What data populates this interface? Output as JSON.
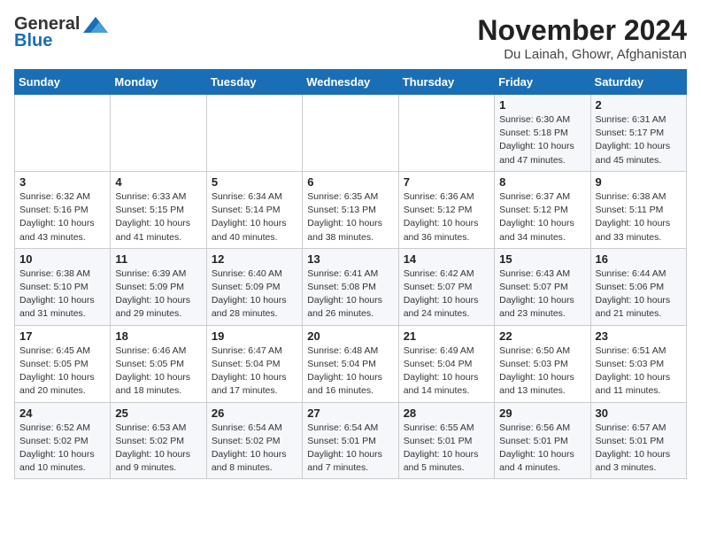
{
  "logo": {
    "line1": "General",
    "line2": "Blue"
  },
  "title": "November 2024",
  "subtitle": "Du Lainah, Ghowr, Afghanistan",
  "header_color": "#1a6eb5",
  "days_of_week": [
    "Sunday",
    "Monday",
    "Tuesday",
    "Wednesday",
    "Thursday",
    "Friday",
    "Saturday"
  ],
  "weeks": [
    [
      {
        "day": "",
        "info": ""
      },
      {
        "day": "",
        "info": ""
      },
      {
        "day": "",
        "info": ""
      },
      {
        "day": "",
        "info": ""
      },
      {
        "day": "",
        "info": ""
      },
      {
        "day": "1",
        "info": "Sunrise: 6:30 AM\nSunset: 5:18 PM\nDaylight: 10 hours and 47 minutes."
      },
      {
        "day": "2",
        "info": "Sunrise: 6:31 AM\nSunset: 5:17 PM\nDaylight: 10 hours and 45 minutes."
      }
    ],
    [
      {
        "day": "3",
        "info": "Sunrise: 6:32 AM\nSunset: 5:16 PM\nDaylight: 10 hours and 43 minutes."
      },
      {
        "day": "4",
        "info": "Sunrise: 6:33 AM\nSunset: 5:15 PM\nDaylight: 10 hours and 41 minutes."
      },
      {
        "day": "5",
        "info": "Sunrise: 6:34 AM\nSunset: 5:14 PM\nDaylight: 10 hours and 40 minutes."
      },
      {
        "day": "6",
        "info": "Sunrise: 6:35 AM\nSunset: 5:13 PM\nDaylight: 10 hours and 38 minutes."
      },
      {
        "day": "7",
        "info": "Sunrise: 6:36 AM\nSunset: 5:12 PM\nDaylight: 10 hours and 36 minutes."
      },
      {
        "day": "8",
        "info": "Sunrise: 6:37 AM\nSunset: 5:12 PM\nDaylight: 10 hours and 34 minutes."
      },
      {
        "day": "9",
        "info": "Sunrise: 6:38 AM\nSunset: 5:11 PM\nDaylight: 10 hours and 33 minutes."
      }
    ],
    [
      {
        "day": "10",
        "info": "Sunrise: 6:38 AM\nSunset: 5:10 PM\nDaylight: 10 hours and 31 minutes."
      },
      {
        "day": "11",
        "info": "Sunrise: 6:39 AM\nSunset: 5:09 PM\nDaylight: 10 hours and 29 minutes."
      },
      {
        "day": "12",
        "info": "Sunrise: 6:40 AM\nSunset: 5:09 PM\nDaylight: 10 hours and 28 minutes."
      },
      {
        "day": "13",
        "info": "Sunrise: 6:41 AM\nSunset: 5:08 PM\nDaylight: 10 hours and 26 minutes."
      },
      {
        "day": "14",
        "info": "Sunrise: 6:42 AM\nSunset: 5:07 PM\nDaylight: 10 hours and 24 minutes."
      },
      {
        "day": "15",
        "info": "Sunrise: 6:43 AM\nSunset: 5:07 PM\nDaylight: 10 hours and 23 minutes."
      },
      {
        "day": "16",
        "info": "Sunrise: 6:44 AM\nSunset: 5:06 PM\nDaylight: 10 hours and 21 minutes."
      }
    ],
    [
      {
        "day": "17",
        "info": "Sunrise: 6:45 AM\nSunset: 5:05 PM\nDaylight: 10 hours and 20 minutes."
      },
      {
        "day": "18",
        "info": "Sunrise: 6:46 AM\nSunset: 5:05 PM\nDaylight: 10 hours and 18 minutes."
      },
      {
        "day": "19",
        "info": "Sunrise: 6:47 AM\nSunset: 5:04 PM\nDaylight: 10 hours and 17 minutes."
      },
      {
        "day": "20",
        "info": "Sunrise: 6:48 AM\nSunset: 5:04 PM\nDaylight: 10 hours and 16 minutes."
      },
      {
        "day": "21",
        "info": "Sunrise: 6:49 AM\nSunset: 5:04 PM\nDaylight: 10 hours and 14 minutes."
      },
      {
        "day": "22",
        "info": "Sunrise: 6:50 AM\nSunset: 5:03 PM\nDaylight: 10 hours and 13 minutes."
      },
      {
        "day": "23",
        "info": "Sunrise: 6:51 AM\nSunset: 5:03 PM\nDaylight: 10 hours and 11 minutes."
      }
    ],
    [
      {
        "day": "24",
        "info": "Sunrise: 6:52 AM\nSunset: 5:02 PM\nDaylight: 10 hours and 10 minutes."
      },
      {
        "day": "25",
        "info": "Sunrise: 6:53 AM\nSunset: 5:02 PM\nDaylight: 10 hours and 9 minutes."
      },
      {
        "day": "26",
        "info": "Sunrise: 6:54 AM\nSunset: 5:02 PM\nDaylight: 10 hours and 8 minutes."
      },
      {
        "day": "27",
        "info": "Sunrise: 6:54 AM\nSunset: 5:01 PM\nDaylight: 10 hours and 7 minutes."
      },
      {
        "day": "28",
        "info": "Sunrise: 6:55 AM\nSunset: 5:01 PM\nDaylight: 10 hours and 5 minutes."
      },
      {
        "day": "29",
        "info": "Sunrise: 6:56 AM\nSunset: 5:01 PM\nDaylight: 10 hours and 4 minutes."
      },
      {
        "day": "30",
        "info": "Sunrise: 6:57 AM\nSunset: 5:01 PM\nDaylight: 10 hours and 3 minutes."
      }
    ]
  ]
}
